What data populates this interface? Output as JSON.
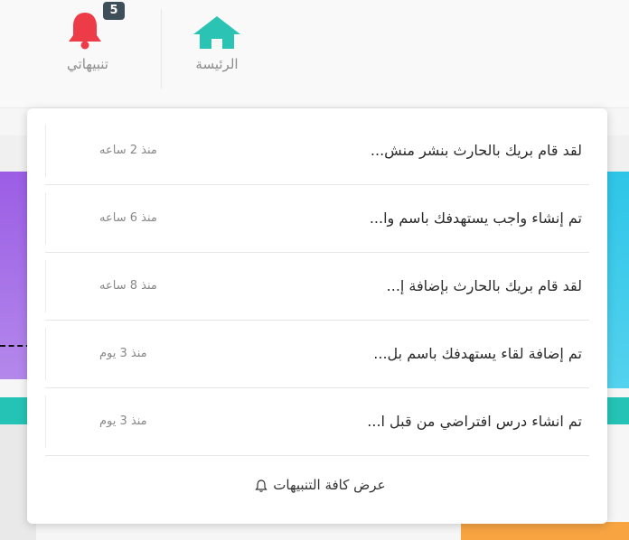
{
  "header": {
    "nav": [
      {
        "label": "الرئيسة",
        "icon": "home-icon"
      },
      {
        "label": "تنبيهاتي",
        "icon": "bell-icon",
        "badge": "5"
      }
    ]
  },
  "colors": {
    "home_icon": "#2bc4b4",
    "bell_icon": "#ee3b48",
    "badge_bg": "#3f4f5a"
  },
  "notifications": {
    "items": [
      {
        "text": "لقد قام بريك بالحارث بنشر منش...",
        "time": "منذ 2 ساعه"
      },
      {
        "text": "تم إنشاء واجب يستهدفك باسم وا...",
        "time": "منذ 6 ساعه"
      },
      {
        "text": "لقد قام بريك بالحارث بإضافة إ...",
        "time": "منذ 8 ساعه"
      },
      {
        "text": "تم إضافة لقاء يستهدفك باسم بل...",
        "time": "منذ 3 يوم"
      },
      {
        "text": "تم انشاء درس افتراضي من قبل ا...",
        "time": "منذ 3 يوم"
      }
    ],
    "view_all": "عرض كافة التنبيهات"
  }
}
